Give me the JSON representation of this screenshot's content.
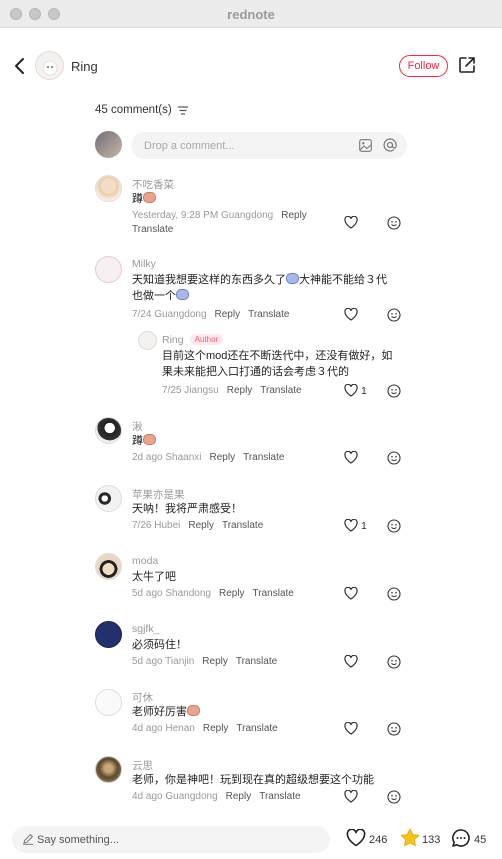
{
  "window": {
    "title": "rednote"
  },
  "header": {
    "author_name": "Ring",
    "follow_label": "Follow"
  },
  "comments_header": {
    "count_label": "45 comment(s)"
  },
  "composer": {
    "placeholder": "Drop a comment..."
  },
  "actions": {
    "reply": "Reply",
    "translate": "Translate"
  },
  "comments": [
    {
      "user": "不吃香菜",
      "text": "蹲",
      "meta": "Yesterday, 9:28 PM Guangdong",
      "likes": ""
    },
    {
      "user": "Milky",
      "text": "天知道我想要这样的东西多久了",
      "text2": "大神能不能给３代也做一个",
      "meta": "7/24 Guangdong",
      "likes": ""
    },
    {
      "user": "Ring",
      "author_tag": "Author",
      "text": "目前这个mod还在不断迭代中，还没有做好，如果未来能把入口打通的话会考虑３代的",
      "meta": "7/25 Jiangsu",
      "likes": "1"
    },
    {
      "user": "湫",
      "text": "蹲",
      "meta": "2d ago Shaanxi",
      "likes": ""
    },
    {
      "user": "苹果亦是果",
      "text": "天呐！我将严肃感受！",
      "meta": "7/26 Hubei",
      "likes": "1"
    },
    {
      "user": "moda",
      "text": "太牛了吧",
      "meta": "5d ago Shandong",
      "likes": ""
    },
    {
      "user": "sgjfk_",
      "text": "必须码住！",
      "meta": "5d ago Tianjin",
      "likes": ""
    },
    {
      "user": "可休",
      "text": "老师好厉害",
      "meta": "4d ago Henan",
      "likes": ""
    },
    {
      "user": "云思",
      "text": "老师，你是神吧！玩到现在真的超级想要这个功能",
      "meta": "4d ago Guangdong",
      "likes": ""
    }
  ],
  "bottom_bar": {
    "placeholder": "Say something...",
    "likes": "246",
    "stars": "133",
    "comments": "45"
  },
  "colors": {
    "accent": "#ff2442",
    "star": "#f5c518",
    "muted": "#9a9a9a"
  }
}
